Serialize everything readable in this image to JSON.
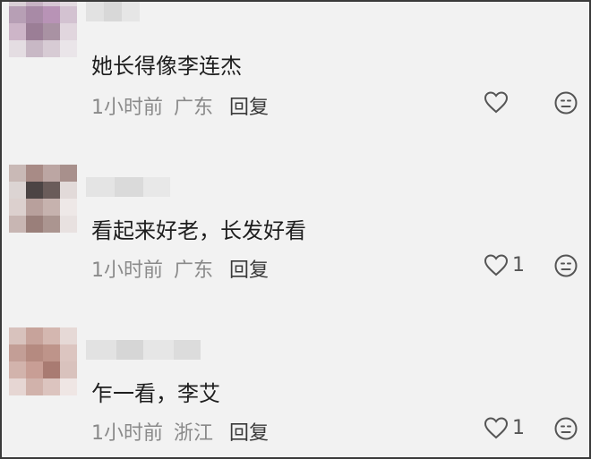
{
  "comments": [
    {
      "text": "她长得像李连杰",
      "time": "1小时前",
      "location": "广东",
      "reply_label": "回复",
      "likes": ""
    },
    {
      "text": "看起来好老，长发好看",
      "time": "1小时前",
      "location": "广东",
      "reply_label": "回复",
      "likes": "1"
    },
    {
      "text": "乍一看，李艾",
      "time": "1小时前",
      "location": "浙江",
      "reply_label": "回复",
      "likes": "1"
    }
  ],
  "icons": {
    "like": "heart-outline-icon",
    "emoji": "emoji-face-icon"
  },
  "colors": {
    "background": "#f2f2f2",
    "text": "#1e1e1e",
    "meta": "#8a8a8a",
    "border": "#3a3a3a"
  }
}
